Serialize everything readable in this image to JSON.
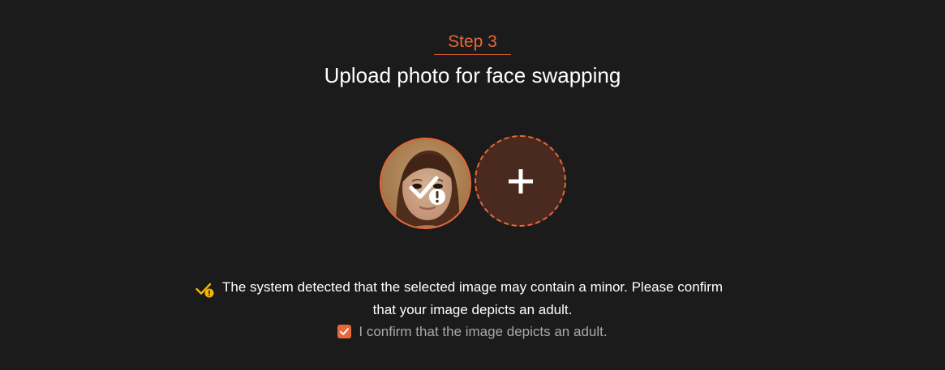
{
  "step": {
    "label": "Step 3",
    "title": "Upload photo for face swapping"
  },
  "photos": {
    "selected_photo": {
      "icon": "check-warning-icon",
      "status": "possible-minor-warning"
    },
    "add_button": {
      "icon": "plus-icon"
    }
  },
  "notice": {
    "icon": "check-warning-icon",
    "line1": "The system detected that the selected image may contain a minor. Please confirm",
    "line2": "that your image depicts an adult."
  },
  "confirmation": {
    "checked": true,
    "label": "I confirm that the image depicts an adult."
  },
  "colors": {
    "accent": "#e8683a",
    "background": "#1b1b1b",
    "warning": "#f5b800"
  }
}
